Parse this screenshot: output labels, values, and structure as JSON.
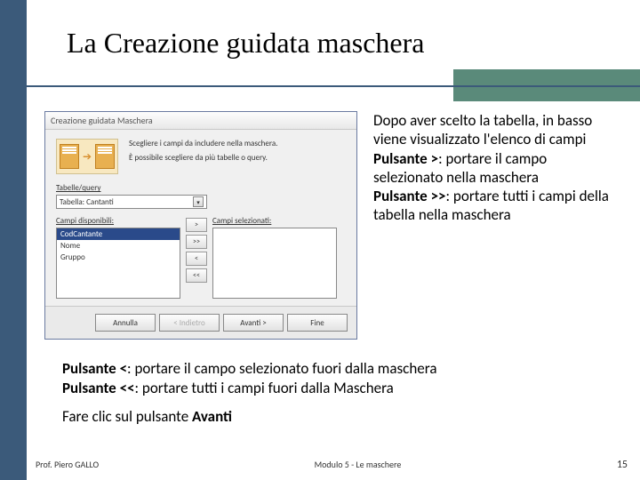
{
  "title": "La Creazione guidata maschera",
  "wizard": {
    "titlebar": "Creazione guidata Maschera",
    "instruction1": "Scegliere i campi da includere nella maschera.",
    "instruction2": "È possibile scegliere da più tabelle o query.",
    "tableLabel": "Tabelle/query",
    "tableValue": "Tabella: Cantanti",
    "availableLabel": "Campi disponibili:",
    "selectedLabel": "Campi selezionati:",
    "items": [
      "CodCantante",
      "Nome",
      "Gruppo"
    ],
    "btnMoveOne": ">",
    "btnMoveAll": ">>",
    "btnBackOne": "<",
    "btnBackAll": "<<",
    "footer": {
      "cancel": "Annulla",
      "back": "< Indietro",
      "next": "Avanti >",
      "finish": "Fine"
    }
  },
  "sideText": {
    "p1": "Dopo aver scelto la tabella, in basso viene visualizzato l'elenco di campi",
    "p2a": "Pulsante >",
    "p2b": ": portare il campo selezionato nella maschera",
    "p3a": "Pulsante >>",
    "p3b": ": portare tutti i campi della tabella nella maschera"
  },
  "belowText": {
    "p1a": "Pulsante <",
    "p1b": ": portare il campo selezionato fuori dalla maschera",
    "p2a": "Pulsante <<",
    "p2b": ": portare tutti i campi fuori dalla Maschera",
    "p3a": "Fare clic sul pulsante ",
    "p3b": "Avanti"
  },
  "footer": {
    "author": "Prof. Piero GALLO",
    "module": "Modulo 5  -  Le maschere",
    "page": "15"
  }
}
